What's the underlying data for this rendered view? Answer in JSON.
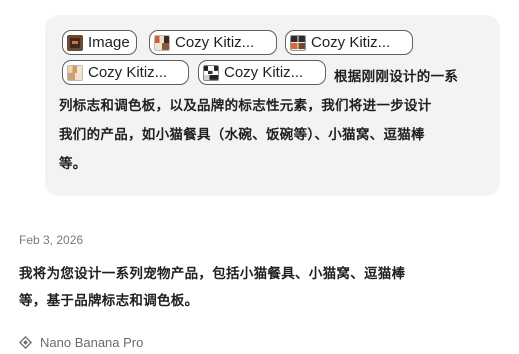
{
  "user_message": {
    "attachments": [
      {
        "label": "Image",
        "thumb": "image-thumbnail"
      },
      {
        "label": "Cozy Kitiz...",
        "thumb": "cozy-kitiz-thumbnail-1"
      },
      {
        "label": "Cozy Kitiz...",
        "thumb": "cozy-kitiz-thumbnail-2"
      },
      {
        "label": "Cozy Kitiz...",
        "thumb": "cozy-kitiz-thumbnail-3"
      },
      {
        "label": "Cozy Kitiz...",
        "thumb": "cozy-kitiz-thumbnail-4"
      }
    ],
    "text_lines": [
      "根据刚刚设计的一系",
      "列标志和调色板，以及品牌的标志性元素，我们将进一步设计",
      "我们的产品，如小猫餐具（水碗、饭碗等）、小猫窝、逗猫棒",
      "等。"
    ],
    "background": "#f3f3f3"
  },
  "response": {
    "timestamp": "Feb 3, 2026",
    "text_lines": [
      "我将为您设计一系列宠物产品，包括小猫餐具、小猫窝、逗猫棒",
      "等，基于品牌标志和调色板。"
    ],
    "model_name": "Nano Banana Pro",
    "model_icon": "sparkle-diamond-icon"
  }
}
